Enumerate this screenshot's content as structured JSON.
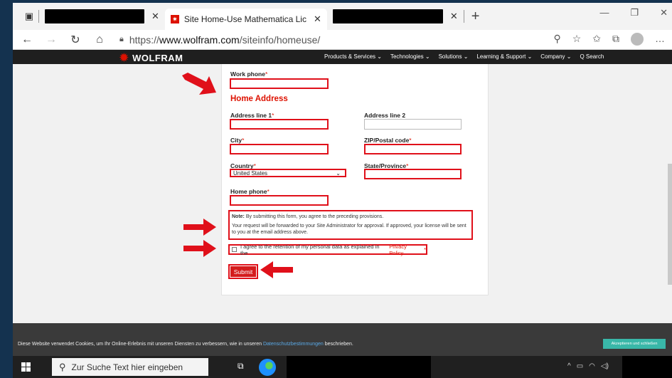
{
  "browser": {
    "tabs": [
      {
        "label": "",
        "redacted": true
      },
      {
        "label": "Site Home-Use Mathematica Lic",
        "active": true
      },
      {
        "label": "",
        "redacted": true
      }
    ],
    "new_tab": "+",
    "url_prefix": "https://",
    "url_domain": "www.wolfram.com",
    "url_path": "/siteinfo/homeuse/"
  },
  "wolfram_nav": {
    "logo": "WOLFRAM",
    "menu": [
      "Products & Services ⌄",
      "Technologies ⌄",
      "Solutions ⌄",
      "Learning & Support ⌄",
      "Company ⌄",
      "Q Search"
    ]
  },
  "form": {
    "work_phone_label": "Work phone",
    "section_title": "Home Address",
    "address1_label": "Address line 1",
    "address2_label": "Address line 2",
    "city_label": "City",
    "zip_label": "ZIP/Postal code",
    "country_label": "Country",
    "country_value": "United States",
    "state_label": "State/Province",
    "home_phone_label": "Home phone",
    "required_mark": "*",
    "note_bold": "Note:",
    "note_text": " By submitting this form, you agree to the preceding provisions.",
    "note_text2": "Your request will be forwarded to your Site Administrator for approval. If approved, your license will be sent to you at the email address above.",
    "agree_text": "I agree to the retention of my personal data as explained in the",
    "agree_link": "Privacy Policy.",
    "submit_label": "Submit"
  },
  "cookie_bar": {
    "text_before": "Diese Website verwendet Cookies, um Ihr Online-Erlebnis mit unseren Diensten zu verbessern, wie in unseren ",
    "link": "Datenschutzbestimmungen",
    "text_after": " beschrieben.",
    "accept_label": "Akzeptieren und schließen"
  },
  "taskbar": {
    "search_placeholder": "Zur Suche Text hier eingeben"
  },
  "colors": {
    "accent_red": "#dd1100",
    "highlight_red": "#e0101a",
    "nav_bg": "#1f1f1f",
    "accept_teal": "#39b7a8"
  }
}
